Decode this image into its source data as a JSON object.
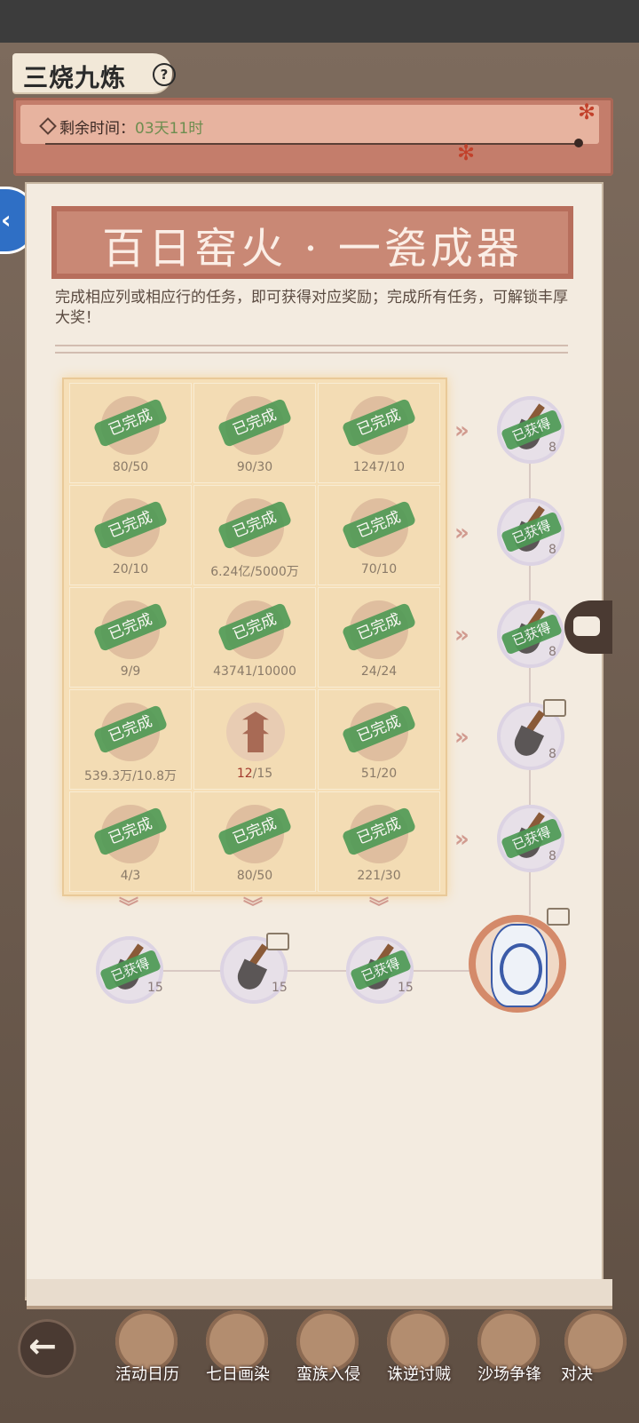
{
  "app": {
    "title": "三烧九炼",
    "help_symbol": "?"
  },
  "timer": {
    "label": "剩余时间：",
    "value": "03天11时"
  },
  "banner": {
    "title": "百日窑火 · 一瓷成器"
  },
  "description": "完成相应列或相应行的任务，即可获得对应奖励；完成所有任务，可解锁丰厚大奖！",
  "grid": {
    "rows": [
      [
        {
          "progress": "80/50",
          "status": "已完成"
        },
        {
          "progress": "90/30",
          "status": "已完成"
        },
        {
          "progress": "1247/10",
          "status": "已完成"
        }
      ],
      [
        {
          "progress": "20/10",
          "status": "已完成"
        },
        {
          "progress": "6.24亿/5000万",
          "status": "已完成"
        },
        {
          "progress": "70/10",
          "status": "已完成"
        }
      ],
      [
        {
          "progress": "9/9",
          "status": "已完成"
        },
        {
          "progress": "43741/10000",
          "status": "已完成"
        },
        {
          "progress": "24/24",
          "status": "已完成"
        }
      ],
      [
        {
          "progress": "539.3万/10.8万",
          "status": "已完成"
        },
        {
          "progress": "12/15",
          "status": ""
        },
        {
          "progress": "51/20",
          "status": "已完成"
        }
      ],
      [
        {
          "progress": "4/3",
          "status": "已完成"
        },
        {
          "progress": "80/50",
          "status": "已完成"
        },
        {
          "progress": "221/30",
          "status": "已完成"
        }
      ]
    ],
    "incomplete_progress_current": "12"
  },
  "row_rewards": [
    {
      "status": "已获得",
      "qty": "8"
    },
    {
      "status": "已获得",
      "qty": "8"
    },
    {
      "status": "已获得",
      "qty": "8"
    },
    {
      "status": "",
      "qty": "8"
    },
    {
      "status": "已获得",
      "qty": "8"
    }
  ],
  "column_rewards": [
    {
      "status": "已获得",
      "qty": "15"
    },
    {
      "status": "",
      "qty": "15"
    },
    {
      "status": "已获得",
      "qty": "15"
    }
  ],
  "nav": {
    "back_symbol": "←",
    "items": [
      "活动日历",
      "七日画染",
      "蛮族入侵",
      "诛逆讨贼",
      "沙场争锋",
      "对决"
    ]
  },
  "colors": {
    "accent": "#c98875",
    "stamp_green": "#4e9a55",
    "timer_value": "#6d8d4f",
    "incomplete_red": "#a23a2e"
  }
}
